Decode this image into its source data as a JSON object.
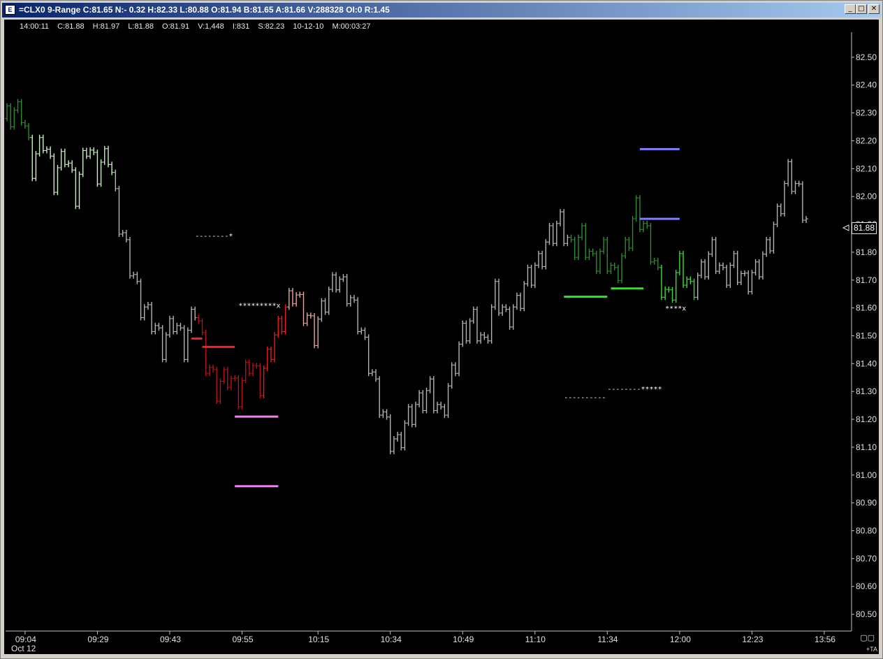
{
  "window": {
    "title": "=CLX0 9-Range C:81.65 N:- 0.32 H:82.33 L:80.88 O:81.94 B:81.65 A:81.66 V:288328 OI:0 R:1.45",
    "icon": "chart-window-icon",
    "icon_glyph": "E",
    "minimize_glyph": "_",
    "maximize_glyph": "□",
    "close_glyph": "✕"
  },
  "status": {
    "time": "14:00:11",
    "close": "C:81.88",
    "high": "H:81.97",
    "low": "L:81.88",
    "open": "O:81.91",
    "volume": "V:1,448",
    "index": "I:831",
    "s": "S:82.23",
    "date": "10-12-10",
    "duration": "M:00:03:27"
  },
  "price_badge": "81.88",
  "corner_buttons": "▢▢",
  "ta_label": "+TA",
  "colors": {
    "background": "#000000",
    "bar_neutral": "#b4b4b4",
    "bar_light_green": "#c8f0c0",
    "bar_dark_green": "#2e8b2e",
    "bar_bright_green": "#3cdc3c",
    "bar_dark_red": "#b41414",
    "bar_bright_red": "#e61e1e",
    "bar_pink": "#e6a8a0",
    "level_magenta": "#ee82ee",
    "level_blue": "#8080ff",
    "level_green": "#28e628",
    "level_red": "#ff1e1e"
  },
  "chart_data": {
    "type": "ohlc",
    "symbol": "CLX0",
    "ylim": [
      80.44,
      82.58
    ],
    "y_ticks": [
      "82.50",
      "82.40",
      "82.30",
      "82.20",
      "82.10",
      "82.00",
      "81.90",
      "81.80",
      "81.70",
      "81.60",
      "81.50",
      "81.40",
      "81.30",
      "81.20",
      "81.10",
      "81.00",
      "80.90",
      "80.80",
      "80.70",
      "80.60",
      "80.50"
    ],
    "x_ticks": [
      {
        "label": "09:04",
        "bar": 5
      },
      {
        "label": "09:29",
        "bar": 25
      },
      {
        "label": "09:43",
        "bar": 45
      },
      {
        "label": "09:55",
        "bar": 65
      },
      {
        "label": "10:15",
        "bar": 86
      },
      {
        "label": "10:34",
        "bar": 106
      },
      {
        "label": "10:49",
        "bar": 126
      },
      {
        "label": "11:10",
        "bar": 146
      },
      {
        "label": "11:34",
        "bar": 166
      },
      {
        "label": "12:00",
        "bar": 186
      },
      {
        "label": "12:23",
        "bar": 206
      },
      {
        "label": "13:56",
        "bar": 226
      }
    ],
    "date_label": "Oct 12",
    "close_path": [
      [
        0,
        82.28
      ],
      [
        4,
        82.3
      ],
      [
        7,
        82.1
      ],
      [
        10,
        82.2
      ],
      [
        13,
        82.05
      ],
      [
        16,
        82.15
      ],
      [
        19,
        82.0
      ],
      [
        22,
        82.18
      ],
      [
        25,
        82.08
      ],
      [
        28,
        82.15
      ],
      [
        31,
        81.9
      ],
      [
        34,
        81.75
      ],
      [
        37,
        81.6
      ],
      [
        40,
        81.55
      ],
      [
        43,
        81.45
      ],
      [
        46,
        81.55
      ],
      [
        49,
        81.45
      ],
      [
        52,
        81.6
      ],
      [
        55,
        81.4
      ],
      [
        58,
        81.3
      ],
      [
        61,
        81.35
      ],
      [
        64,
        81.28
      ],
      [
        67,
        81.4
      ],
      [
        70,
        81.32
      ],
      [
        73,
        81.45
      ],
      [
        76,
        81.55
      ],
      [
        79,
        81.65
      ],
      [
        82,
        81.58
      ],
      [
        85,
        81.5
      ],
      [
        88,
        81.62
      ],
      [
        91,
        81.7
      ],
      [
        94,
        81.65
      ],
      [
        97,
        81.55
      ],
      [
        100,
        81.4
      ],
      [
        103,
        81.25
      ],
      [
        106,
        81.12
      ],
      [
        108,
        81.1
      ],
      [
        111,
        81.2
      ],
      [
        114,
        81.25
      ],
      [
        117,
        81.3
      ],
      [
        120,
        81.2
      ],
      [
        123,
        81.35
      ],
      [
        126,
        81.5
      ],
      [
        129,
        81.55
      ],
      [
        132,
        81.45
      ],
      [
        135,
        81.65
      ],
      [
        138,
        81.55
      ],
      [
        141,
        81.6
      ],
      [
        144,
        81.7
      ],
      [
        147,
        81.75
      ],
      [
        150,
        81.85
      ],
      [
        153,
        81.9
      ],
      [
        156,
        81.8
      ],
      [
        159,
        81.85
      ],
      [
        162,
        81.75
      ],
      [
        165,
        81.8
      ],
      [
        168,
        81.7
      ],
      [
        171,
        81.8
      ],
      [
        174,
        81.95
      ],
      [
        177,
        81.85
      ],
      [
        180,
        81.7
      ],
      [
        183,
        81.62
      ],
      [
        186,
        81.75
      ],
      [
        189,
        81.65
      ],
      [
        192,
        81.72
      ],
      [
        195,
        81.8
      ],
      [
        198,
        81.7
      ],
      [
        201,
        81.75
      ],
      [
        204,
        81.68
      ],
      [
        207,
        81.72
      ],
      [
        210,
        81.8
      ],
      [
        213,
        81.92
      ],
      [
        216,
        82.08
      ],
      [
        219,
        82.0
      ],
      [
        221,
        81.9
      ]
    ],
    "color_segments": [
      {
        "from": 0,
        "to": 6,
        "color": "#2e8b2e"
      },
      {
        "from": 7,
        "to": 29,
        "color": "#c8f0c0"
      },
      {
        "from": 30,
        "to": 52,
        "color": "#b4b4b4"
      },
      {
        "from": 53,
        "to": 62,
        "color": "#b41414"
      },
      {
        "from": 63,
        "to": 70,
        "color": "#b41414"
      },
      {
        "from": 71,
        "to": 77,
        "color": "#e61e1e"
      },
      {
        "from": 78,
        "to": 86,
        "color": "#e6a8a0"
      },
      {
        "from": 87,
        "to": 155,
        "color": "#b4b4b4"
      },
      {
        "from": 156,
        "to": 180,
        "color": "#2e8b2e"
      },
      {
        "from": 181,
        "to": 190,
        "color": "#3cdc3c"
      },
      {
        "from": 191,
        "to": 221,
        "color": "#b4b4b4"
      }
    ],
    "level_lines": [
      {
        "from_bar": 63,
        "to_bar": 75,
        "price": 81.21,
        "color": "#ee82ee"
      },
      {
        "from_bar": 63,
        "to_bar": 75,
        "price": 80.96,
        "color": "#ee82ee"
      },
      {
        "from_bar": 54,
        "to_bar": 63,
        "price": 81.46,
        "color": "#ff1e1e"
      },
      {
        "from_bar": 51,
        "to_bar": 54,
        "price": 81.49,
        "color": "#ff1e1e"
      },
      {
        "from_bar": 175,
        "to_bar": 186,
        "price": 82.17,
        "color": "#8080ff"
      },
      {
        "from_bar": 175,
        "to_bar": 186,
        "price": 81.92,
        "color": "#8080ff"
      },
      {
        "from_bar": 154,
        "to_bar": 166,
        "price": 81.64,
        "color": "#28e628"
      },
      {
        "from_bar": 167,
        "to_bar": 176,
        "price": 81.67,
        "color": "#28e628"
      }
    ],
    "marker_texts": [
      {
        "text": "--------*",
        "bar": 52,
        "price": 81.86
      },
      {
        "text": "*********x",
        "bar": 64,
        "price": 81.61
      },
      {
        "text": "----------",
        "bar": 154,
        "price": 81.28
      },
      {
        "text": "--------*****",
        "bar": 166,
        "price": 81.31
      },
      {
        "text": "****x",
        "bar": 182,
        "price": 81.6
      }
    ]
  }
}
